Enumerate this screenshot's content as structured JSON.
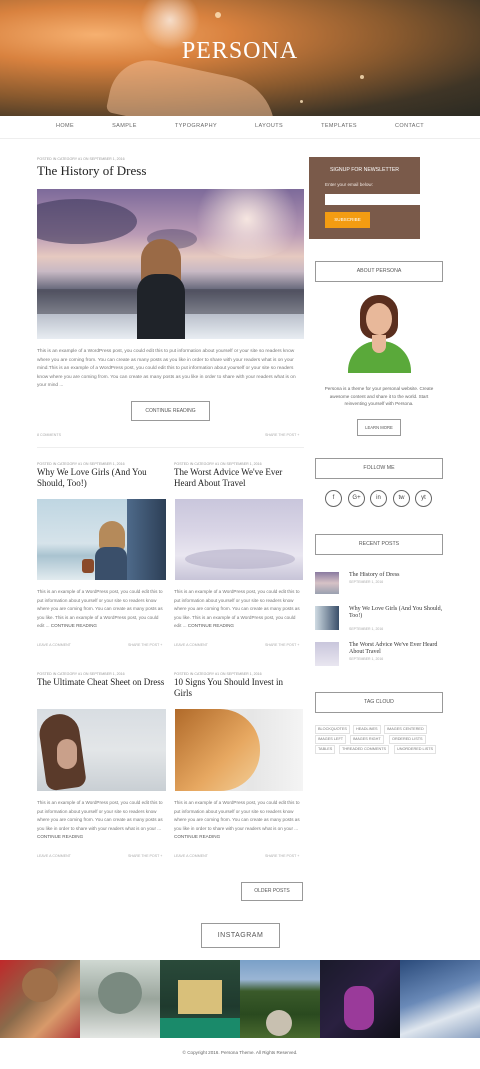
{
  "site": {
    "title": "PERSONA"
  },
  "nav": [
    "HOME",
    "SAMPLE",
    "TYPOGRAPHY",
    "LAYOUTS",
    "TEMPLATES",
    "CONTACT"
  ],
  "featured": {
    "meta": "POSTED IN CATEGORY #1 ON SEPTEMBER 1, 2016",
    "title": "The History of Dress",
    "excerpt": "This is an example of a WordPress post, you could edit this to put information about yourself or your site so readers know where you are coming from. You can create as many posts as you like in order to share with your readers what is on your mind.This is an example of a WordPress post, you could edit this to put information about yourself or your site so readers know where you are coming from. You can create as many posts as you like in order to share with your readers what is on your mind ...",
    "button": "CONTINUE READING",
    "comments": "8 COMMENTS",
    "share": "SHARE THE POST +"
  },
  "posts": [
    {
      "meta": "POSTED IN CATEGORY #1 ON SEPTEMBER 1, 2016",
      "title": "Why We Love Girls (And You Should, Too!)",
      "excerpt": "This is an example of a WordPress post, you could edit this to put information about yourself or your site so readers know where you are coming from. You can create as many posts as you like. This is an example of a WordPress post, you could edit ...",
      "more": "CONTINUE READING",
      "comment": "LEAVE A COMMENT",
      "share": "SHARE THE POST +"
    },
    {
      "meta": "POSTED IN CATEGORY #1 ON SEPTEMBER 1, 2016",
      "title": "The Worst Advice We've Ever Heard About Travel",
      "excerpt": "This is an example of a WordPress post, you could edit this to put information about yourself or your site so readers know where you are coming from. You can create as many posts as you like. This is an example of a WordPress post, you could edit ...",
      "more": "CONTINUE READING",
      "comment": "LEAVE A COMMENT",
      "share": "SHARE THE POST +"
    },
    {
      "meta": "POSTED IN CATEGORY #1 ON SEPTEMBER 1, 2016",
      "title": "The Ultimate Cheat Sheet on Dress",
      "excerpt": "This is an example of a WordPress post, you could edit this to put information about yourself or your site so readers know where you are coming from. You can create as many posts as you like in order to share with your readers what is on your ...",
      "more": "CONTINUE READING",
      "comment": "LEAVE A COMMENT",
      "share": "SHARE THE POST +"
    },
    {
      "meta": "POSTED IN CATEGORY #1 ON SEPTEMBER 1, 2016",
      "title": "10 Signs You Should Invest in Girls",
      "excerpt": "This is an example of a WordPress post, you could edit this to put information about yourself or your site so readers know where you are coming from. You can create as many posts as you like in order to share with your readers what is on your ...",
      "more": "CONTINUE READING",
      "comment": "LEAVE A COMMENT",
      "share": "SHARE THE POST +"
    }
  ],
  "older_posts": "OLDER POSTS",
  "sidebar": {
    "newsletter": {
      "title": "SIGNUP FOR NEWSLETTER",
      "label": "Enter your email below:",
      "button": "SUBSCRIBE"
    },
    "about": {
      "title": "ABOUT PERSONA",
      "text": "Persona is a theme for your personal website. Create awesome content and share it to the world. Start reinventing yourself with Persona.",
      "button": "LEARN MORE"
    },
    "follow": {
      "title": "FOLLOW ME",
      "icons": [
        "f",
        "G+",
        "in",
        "tw",
        "yt"
      ]
    },
    "recent": {
      "title": "RECENT POSTS",
      "items": [
        {
          "title": "The History of Dress",
          "date": "SEPTEMBER 1, 2016"
        },
        {
          "title": "Why We Love Girls (And You Should, Too!)",
          "date": "SEPTEMBER 1, 2016"
        },
        {
          "title": "The Worst Advice We've Ever Heard About Travel",
          "date": "SEPTEMBER 1, 2016"
        }
      ]
    },
    "tags": {
      "title": "TAG CLOUD",
      "items": [
        "BLOCKQUOTES",
        "HEADLINES",
        "IMAGES CENTERED",
        "IMAGES LEFT",
        "IMAGES RIGHT",
        "ORDERED LISTS",
        "TABLES",
        "THREADED COMMENTS",
        "UNORDERED LISTS"
      ]
    }
  },
  "instagram": {
    "title": "INSTAGRAM"
  },
  "footer": {
    "copyright": "© Copyright 2016. Persona Theme. All Rights Reserved."
  },
  "colors": {
    "accent": "#f39c12",
    "newsletter_bg": "#7a5a4a",
    "hero_dark": "#2b2a22"
  }
}
